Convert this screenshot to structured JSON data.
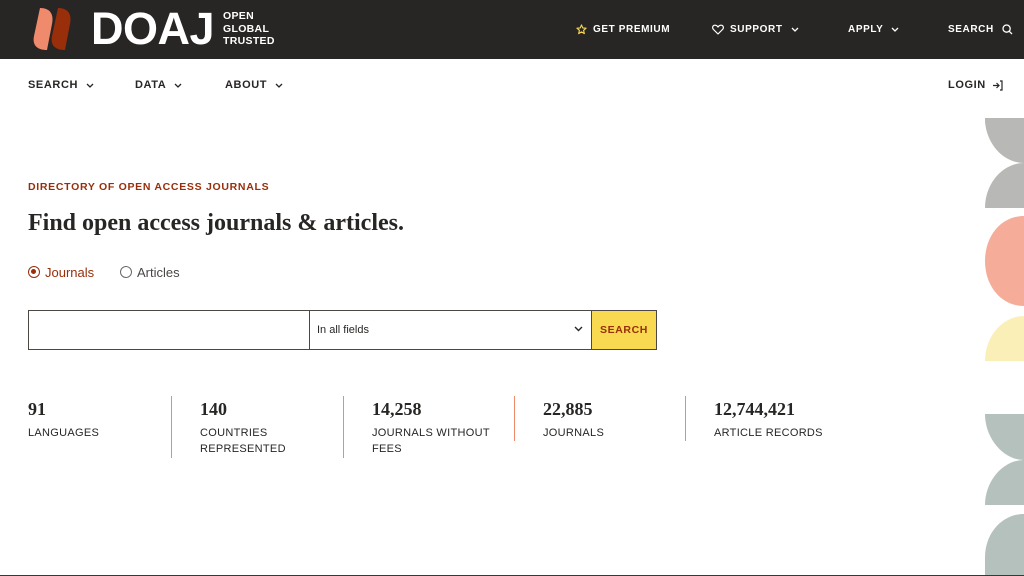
{
  "brand": {
    "name": "DOAJ",
    "tagline": [
      "OPEN",
      "GLOBAL",
      "TRUSTED"
    ],
    "colors": {
      "dark": "#282624",
      "accent": "#982e0a",
      "salmon": "#f08a6c",
      "yellow": "#f9d950"
    }
  },
  "topnav": {
    "premium": "GET PREMIUM",
    "support": "SUPPORT",
    "apply": "APPLY",
    "search": "SEARCH"
  },
  "subnav": {
    "search": "SEARCH",
    "data": "DATA",
    "about": "ABOUT",
    "login": "LOGIN"
  },
  "hero": {
    "eyebrow": "DIRECTORY OF OPEN ACCESS JOURNALS",
    "headline": "Find open access journals & articles.",
    "radios": [
      {
        "label": "Journals",
        "checked": true
      },
      {
        "label": "Articles",
        "checked": false
      }
    ]
  },
  "search": {
    "query_value": "",
    "field_select": "In all fields",
    "button_label": "SEARCH"
  },
  "stats": [
    {
      "value": "91",
      "label": "LANGUAGES"
    },
    {
      "value": "140",
      "label": "COUNTRIES REPRESENTED"
    },
    {
      "value": "14,258",
      "label": "JOURNALS WITHOUT FEES"
    },
    {
      "value": "22,885",
      "label": "JOURNALS"
    },
    {
      "value": "12,744,421",
      "label": "ARTICLE RECORDS"
    }
  ]
}
